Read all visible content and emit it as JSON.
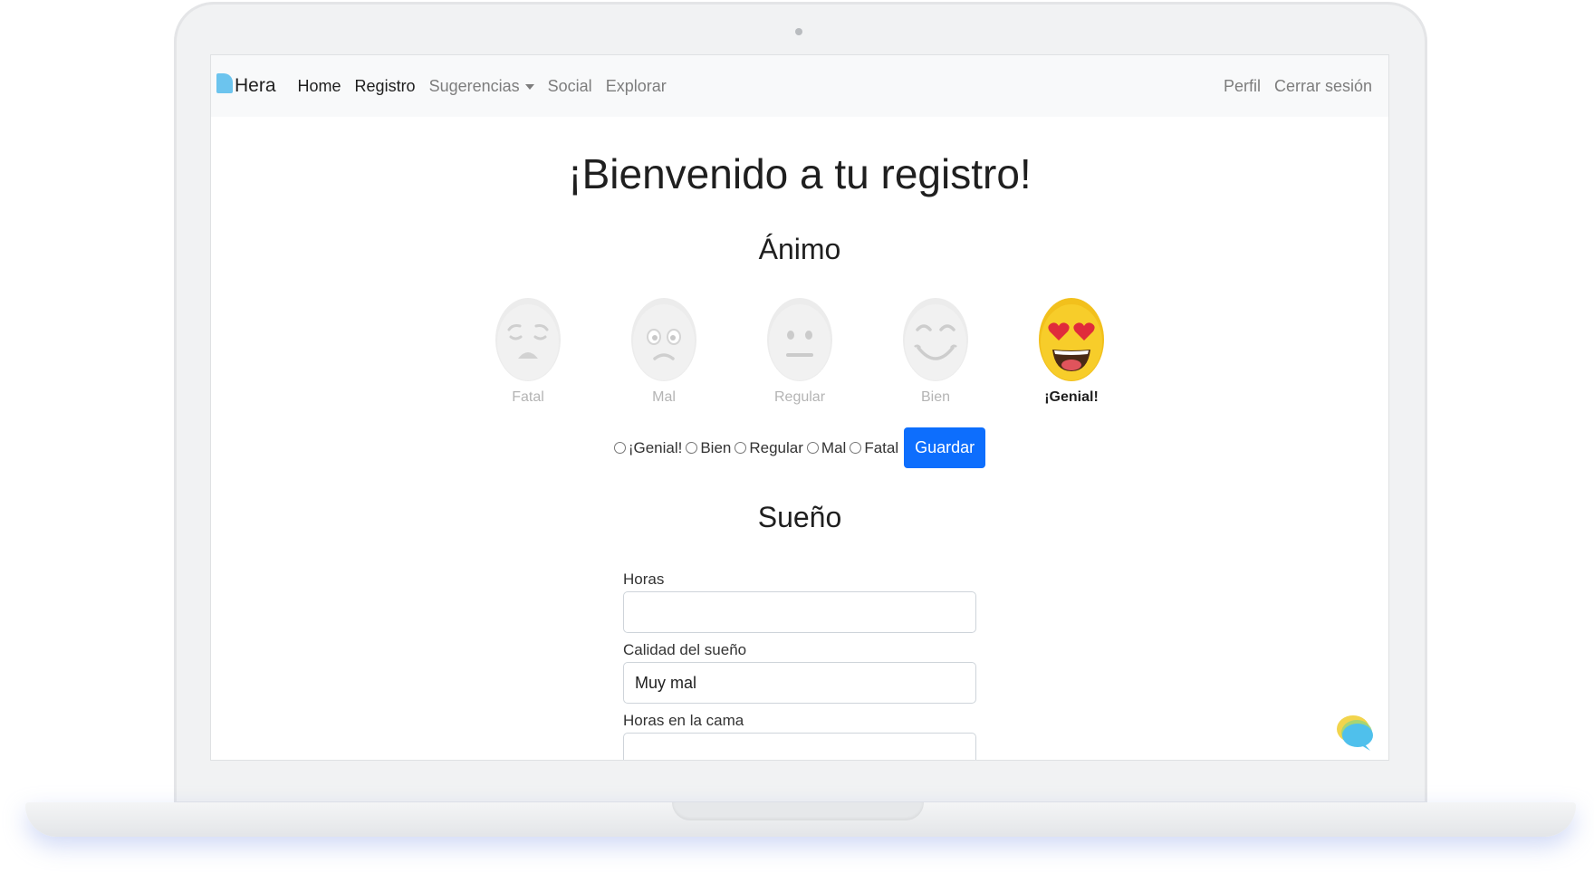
{
  "brand": {
    "name": "Hera",
    "color": "#6cc4ee"
  },
  "nav": {
    "links": [
      "Home",
      "Registro",
      "Sugerencias",
      "Social",
      "Explorar"
    ],
    "active": [
      "Home",
      "Registro"
    ],
    "right": [
      "Perfil",
      "Cerrar sesión"
    ]
  },
  "page": {
    "title": "¡Bienvenido a tu registro!"
  },
  "animo": {
    "title": "Ánimo",
    "moods": [
      {
        "label": "Fatal",
        "icon": "pained-face-icon"
      },
      {
        "label": "Mal",
        "icon": "sad-face-icon"
      },
      {
        "label": "Regular",
        "icon": "neutral-face-icon"
      },
      {
        "label": "Bien",
        "icon": "smiling-face-icon"
      },
      {
        "label": "¡Genial!",
        "icon": "heart-eyes-face-icon"
      }
    ],
    "selected": "¡Genial!",
    "radio_options": [
      "¡Genial!",
      "Bien",
      "Regular",
      "Mal",
      "Fatal"
    ],
    "save_label": "Guardar"
  },
  "sueno": {
    "title": "Sueño",
    "fields": [
      {
        "label": "Horas",
        "value": ""
      },
      {
        "label": "Calidad del sueño",
        "value": "Muy mal"
      },
      {
        "label": "Horas en la cama",
        "value": ""
      }
    ]
  },
  "colors": {
    "primary_button": "#0d6efd",
    "navbar_bg": "#f8f9fa",
    "emoji_yellow": "#f5c518",
    "emoji_disabled": "#ececec"
  },
  "chat_widget": {
    "icon": "chat-bubble-icon"
  }
}
